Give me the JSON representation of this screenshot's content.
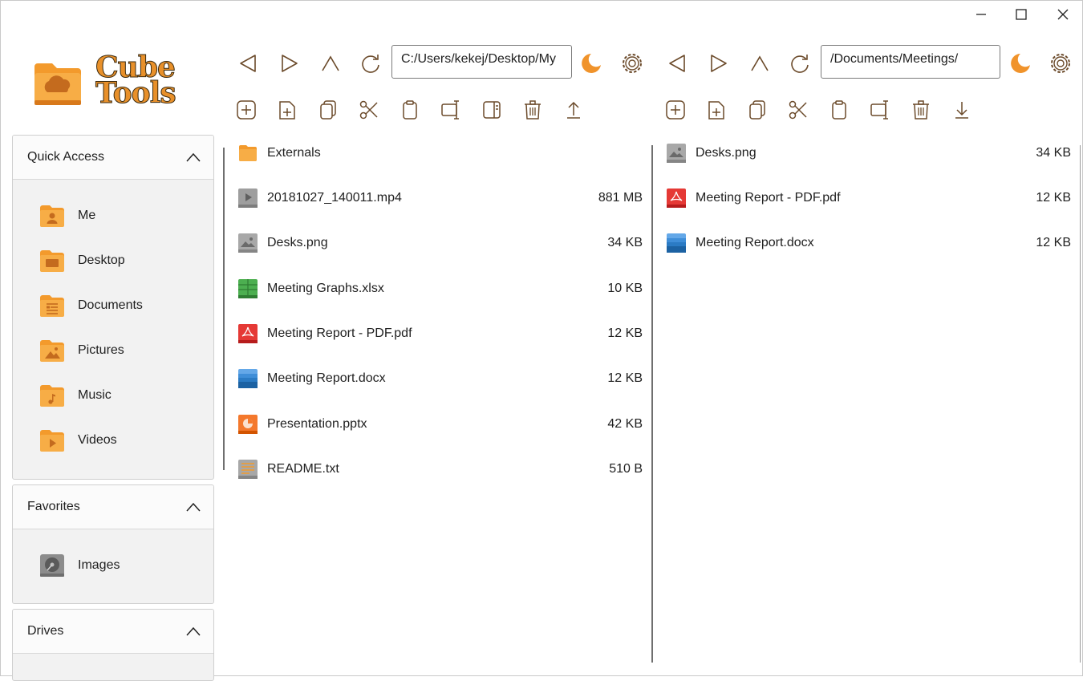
{
  "app": {
    "logo_line1": "Cube",
    "logo_line2": "Tools"
  },
  "sidebar": {
    "quick_access": {
      "title": "Quick Access",
      "items": [
        {
          "label": "Me",
          "icon": "user-folder-icon"
        },
        {
          "label": "Desktop",
          "icon": "desktop-folder-icon"
        },
        {
          "label": "Documents",
          "icon": "documents-folder-icon"
        },
        {
          "label": "Pictures",
          "icon": "pictures-folder-icon"
        },
        {
          "label": "Music",
          "icon": "music-folder-icon"
        },
        {
          "label": "Videos",
          "icon": "videos-folder-icon"
        }
      ]
    },
    "favorites": {
      "title": "Favorites",
      "items": [
        {
          "label": "Images",
          "icon": "drive-icon"
        }
      ]
    },
    "drives": {
      "title": "Drives"
    }
  },
  "left_pane": {
    "path": "C:/Users/kekej/Desktop/My",
    "files": [
      {
        "name": "Externals",
        "size": "",
        "icon": "folder-icon"
      },
      {
        "name": "20181027_140011.mp4",
        "size": "881 MB",
        "icon": "video-file-icon"
      },
      {
        "name": "Desks.png",
        "size": "34 KB",
        "icon": "image-file-icon"
      },
      {
        "name": "Meeting Graphs.xlsx",
        "size": "10 KB",
        "icon": "spreadsheet-file-icon"
      },
      {
        "name": "Meeting Report - PDF.pdf",
        "size": "12 KB",
        "icon": "pdf-file-icon"
      },
      {
        "name": "Meeting Report.docx",
        "size": "12 KB",
        "icon": "document-file-icon"
      },
      {
        "name": "Presentation.pptx",
        "size": "42 KB",
        "icon": "presentation-file-icon"
      },
      {
        "name": "README.txt",
        "size": "510 B",
        "icon": "text-file-icon"
      }
    ]
  },
  "right_pane": {
    "path": "/Documents/Meetings/",
    "files": [
      {
        "name": "Desks.png",
        "size": "34 KB",
        "icon": "image-file-icon"
      },
      {
        "name": "Meeting Report - PDF.pdf",
        "size": "12 KB",
        "icon": "pdf-file-icon"
      },
      {
        "name": "Meeting Report.docx",
        "size": "12 KB",
        "icon": "document-file-icon"
      }
    ]
  },
  "colors": {
    "accent": "#f0932b",
    "icon_stroke": "#6b4a2a",
    "panel_bg": "#f2f2f2"
  }
}
